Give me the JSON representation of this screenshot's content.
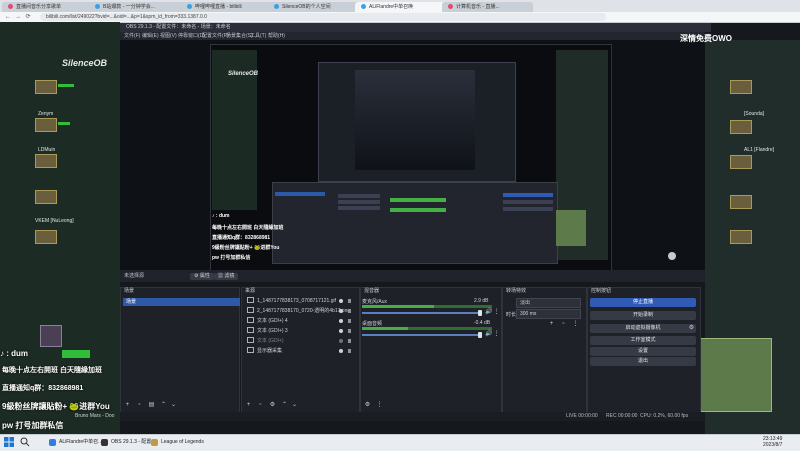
{
  "browser": {
    "tabs": [
      {
        "label": "直播间音乐分享歌单",
        "active": false
      },
      {
        "label": "B站爆款 - 一分钟学会...",
        "active": false
      },
      {
        "label": "哔哩哔哩直播 - bilibili",
        "active": false
      },
      {
        "label": "SilenceOB的个人空间",
        "active": false
      },
      {
        "label": "ALiFlandre中单召唤",
        "active": true
      },
      {
        "label": "计算机音乐 - 直播...",
        "active": false
      }
    ],
    "url": "bilibili.com/list/249022?bvid=...&oid=...&p=1&spm_id_from=333.1387.0.0",
    "nav": {
      "back": "←",
      "forward": "→",
      "reload": "⟳"
    }
  },
  "obs": {
    "title": "OBS 29.1.3 - 配置文件：未命名 - 场景：未命名",
    "menu": [
      "文件(F)",
      "编辑(E)",
      "视图(V)",
      "停靠窗口(D)",
      "配置文件(P)",
      "场景集合(S)",
      "工具(T)",
      "帮助(H)"
    ],
    "scene_bar": {
      "label": "未选择源",
      "buttons": [
        "⚙ 属性",
        "▦ 滤镜"
      ]
    },
    "docks": {
      "scenes": {
        "title": "场景",
        "items": [
          "场景"
        ]
      },
      "sources": {
        "title": "来源",
        "items": [
          "1_1487177838173_0708717121.gif",
          "2_1487177838170_0720-透明的4b17.png",
          "文本 (GDI+) 4",
          "文本 (GDI+) 3",
          "文本 (GDI+)",
          "显示器采集"
        ]
      },
      "mixer": {
        "title": "混音器",
        "channels": [
          {
            "name": "麦克风/Aux",
            "db": "2.9 dB",
            "level": 0.55
          },
          {
            "name": "桌面音频",
            "db": "-0.4 dB",
            "level": 0.35
          }
        ]
      },
      "transitions": {
        "title": "转场特效",
        "type": "淡出",
        "duration_label": "时长",
        "duration": "300 ms"
      },
      "controls": {
        "title": "控制按钮",
        "buttons": [
          "停止直播",
          "开始录制",
          "启动虚拟摄像机",
          "工作室模式",
          "设置",
          "退出"
        ]
      }
    },
    "status": {
      "live": "LIVE 00:00:00",
      "rec": "REC 00:00:00",
      "cpu": "CPU: 0.2%, 60.00 fps"
    }
  },
  "overlays": {
    "platform": "♪ : dum",
    "line1": "每晚十点左右開班  白天隨緣加班",
    "line2": "直播通知q群：832868981",
    "line3": "9級粉丝牌讓貼粉+  🐸进群You",
    "line4": "pw 打号加群私信",
    "song": "Bruno Mars - Doo",
    "watermark": "SilenceOB",
    "logo": "深情免费OWO"
  },
  "game_names": {
    "left": [
      "Zenym",
      "LDMuin",
      "VKEM [NuLeong]"
    ],
    "right": [
      "[Sounda]",
      "AL1 [Flandre]"
    ]
  },
  "taskbar": {
    "items": [
      "ALiFlandre中单召...",
      "OBS 29.1.3 - 配置...",
      "League of Legends"
    ],
    "time": "23:13:49",
    "date": "2023/8/7"
  }
}
